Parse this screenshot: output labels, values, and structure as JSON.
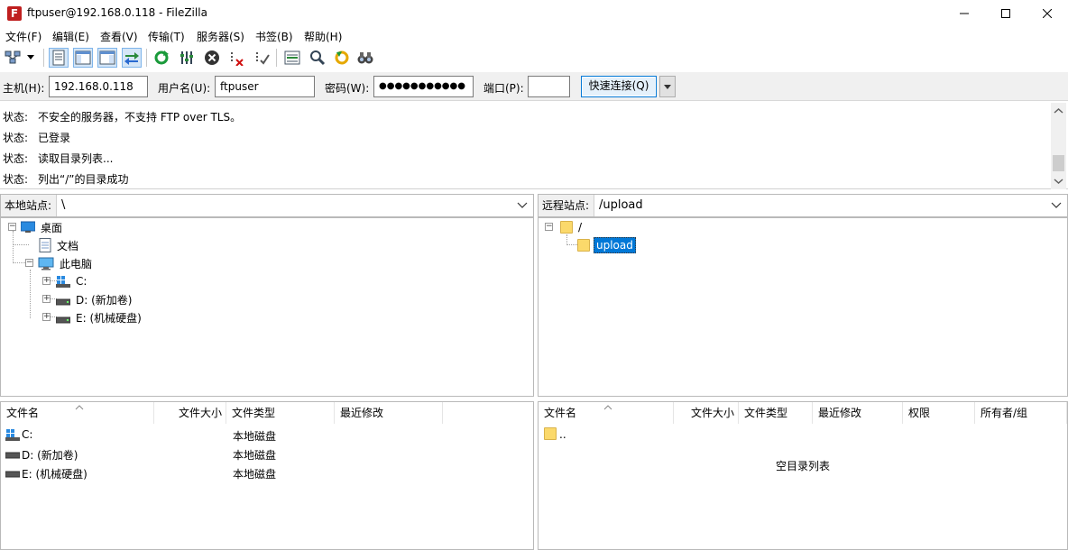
{
  "window": {
    "title": "ftpuser@192.168.0.118 - FileZilla",
    "app_icon": "F",
    "controls": [
      "minimize-icon",
      "maximize-icon",
      "close-icon"
    ]
  },
  "menu": [
    {
      "label": "文件(F)"
    },
    {
      "label": "编辑(E)"
    },
    {
      "label": "查看(V)"
    },
    {
      "label": "传输(T)"
    },
    {
      "label": "服务器(S)"
    },
    {
      "label": "书签(B)"
    },
    {
      "label": "帮助(H)"
    }
  ],
  "toolbar": {
    "icons": [
      "site-manager-icon",
      "dropdown-arrow-icon",
      "toggle-log-icon",
      "toggle-local-tree-icon",
      "toggle-remote-tree-icon",
      "toggle-queue-icon",
      "refresh-icon",
      "process-queue-icon",
      "cancel-icon",
      "disconnect-icon",
      "reconnect-icon",
      "directory-filter-icon",
      "compare-icon",
      "sync-browse-icon",
      "search-binoculars-icon"
    ]
  },
  "quickconnect": {
    "host_label": "主机(H):",
    "host_value": "192.168.0.118",
    "user_label": "用户名(U):",
    "user_value": "ftpuser",
    "pass_label": "密码(W):",
    "pass_value": "●●●●●●●●●●●",
    "port_label": "端口(P):",
    "port_value": "",
    "button_label": "快速连接(Q)"
  },
  "log": [
    {
      "label": "状态:",
      "text": "不安全的服务器，不支持 FTP over TLS。"
    },
    {
      "label": "状态:",
      "text": "已登录"
    },
    {
      "label": "状态:",
      "text": "读取目录列表..."
    },
    {
      "label": "状态:",
      "text": "列出“/”的目录成功"
    }
  ],
  "local": {
    "site_label": "本地站点:",
    "path": "\\",
    "tree": [
      {
        "label": "桌面",
        "expander": "⊟"
      },
      {
        "label": "文档"
      },
      {
        "label": "此电脑",
        "expander": "⊟"
      },
      {
        "label": "C:",
        "expander": "+"
      },
      {
        "label": "D: (新加卷)",
        "expander": "+"
      },
      {
        "label": "E: (机械硬盘)",
        "expander": "+"
      }
    ],
    "columns": [
      "文件名",
      "文件大小",
      "文件类型",
      "最近修改"
    ],
    "files": [
      {
        "name": "C:",
        "size": "",
        "type": "本地磁盘",
        "modified": ""
      },
      {
        "name": "D: (新加卷)",
        "size": "",
        "type": "本地磁盘",
        "modified": ""
      },
      {
        "name": "E: (机械硬盘)",
        "size": "",
        "type": "本地磁盘",
        "modified": ""
      }
    ]
  },
  "remote": {
    "site_label": "远程站点:",
    "path": "/upload",
    "tree": [
      {
        "label": "/",
        "expander": "⊟"
      },
      {
        "label": "upload"
      }
    ],
    "columns": [
      "文件名",
      "文件大小",
      "文件类型",
      "最近修改",
      "权限",
      "所有者/组"
    ],
    "files": [
      {
        "name": ".."
      }
    ],
    "empty_message": "空目录列表"
  }
}
